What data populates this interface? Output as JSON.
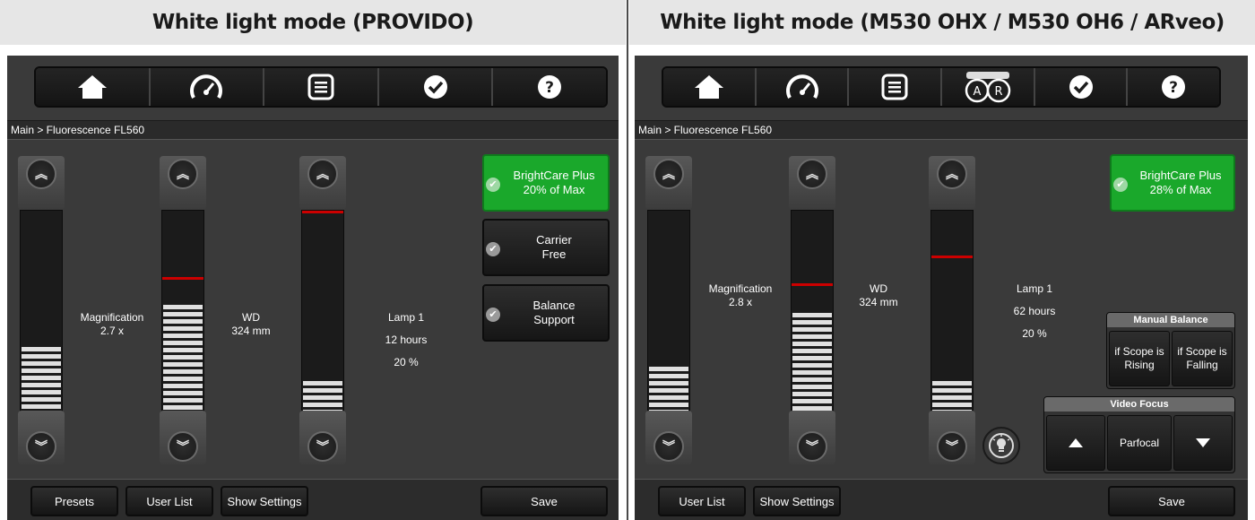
{
  "left": {
    "header": "White light mode (PROVIDO)",
    "breadcrumb": "Main > Fluorescence FL560",
    "nav_icons": [
      "home-icon",
      "speedometer-icon",
      "list-icon",
      "check-icon",
      "help-icon"
    ],
    "sliders": {
      "magnification": {
        "name": "Magnification",
        "value": "2.7 x",
        "level": 0.36
      },
      "wd": {
        "name": "WD",
        "value": "324 mm",
        "level": 0.56,
        "marker": 0.69
      },
      "lamp": {
        "name": "Lamp 1",
        "hours": "12 hours",
        "percent": "20 %",
        "level": 0.2,
        "marker": 1.0
      }
    },
    "options": [
      {
        "line1": "BrightCare Plus",
        "line2": "20% of Max",
        "active": true
      },
      {
        "line1": "Carrier",
        "line2": "Free",
        "active": false
      },
      {
        "line1": "Balance",
        "line2": "Support",
        "active": false
      }
    ],
    "bottom": {
      "presets": "Presets",
      "user_list": "User List",
      "show_settings": "Show Settings",
      "save": "Save"
    }
  },
  "right": {
    "header": "White light mode (M530 OHX / M530 OH6 / ARveo)",
    "breadcrumb": "Main > Fluorescence FL560",
    "nav_icons": [
      "home-icon",
      "speedometer-icon",
      "list-icon",
      "ar-icon",
      "check-icon",
      "help-icon"
    ],
    "ar_letters": [
      "A",
      "R"
    ],
    "sliders": {
      "magnification": {
        "name": "Magnification",
        "value": "2.8 x",
        "level": 0.27
      },
      "wd": {
        "name": "WD",
        "value": "324 mm",
        "level": 0.52,
        "marker": 0.66
      },
      "lamp": {
        "name": "Lamp 1",
        "hours": "62 hours",
        "percent": "20 %",
        "level": 0.2,
        "marker": 0.79
      }
    },
    "options": [
      {
        "line1": "BrightCare Plus",
        "line2": "28% of Max",
        "active": true
      }
    ],
    "manual_balance": {
      "title": "Manual Balance",
      "rising": "if Scope is Rising",
      "falling": "if Scope is Falling"
    },
    "video_focus": {
      "title": "Video Focus",
      "parfocal": "Parfocal"
    },
    "bottom": {
      "user_list": "User List",
      "show_settings": "Show Settings",
      "save": "Save"
    }
  },
  "colors": {
    "active_green": "#1aa82b",
    "marker_red": "#cc0000",
    "panel_bg": "#3a3a3a"
  }
}
